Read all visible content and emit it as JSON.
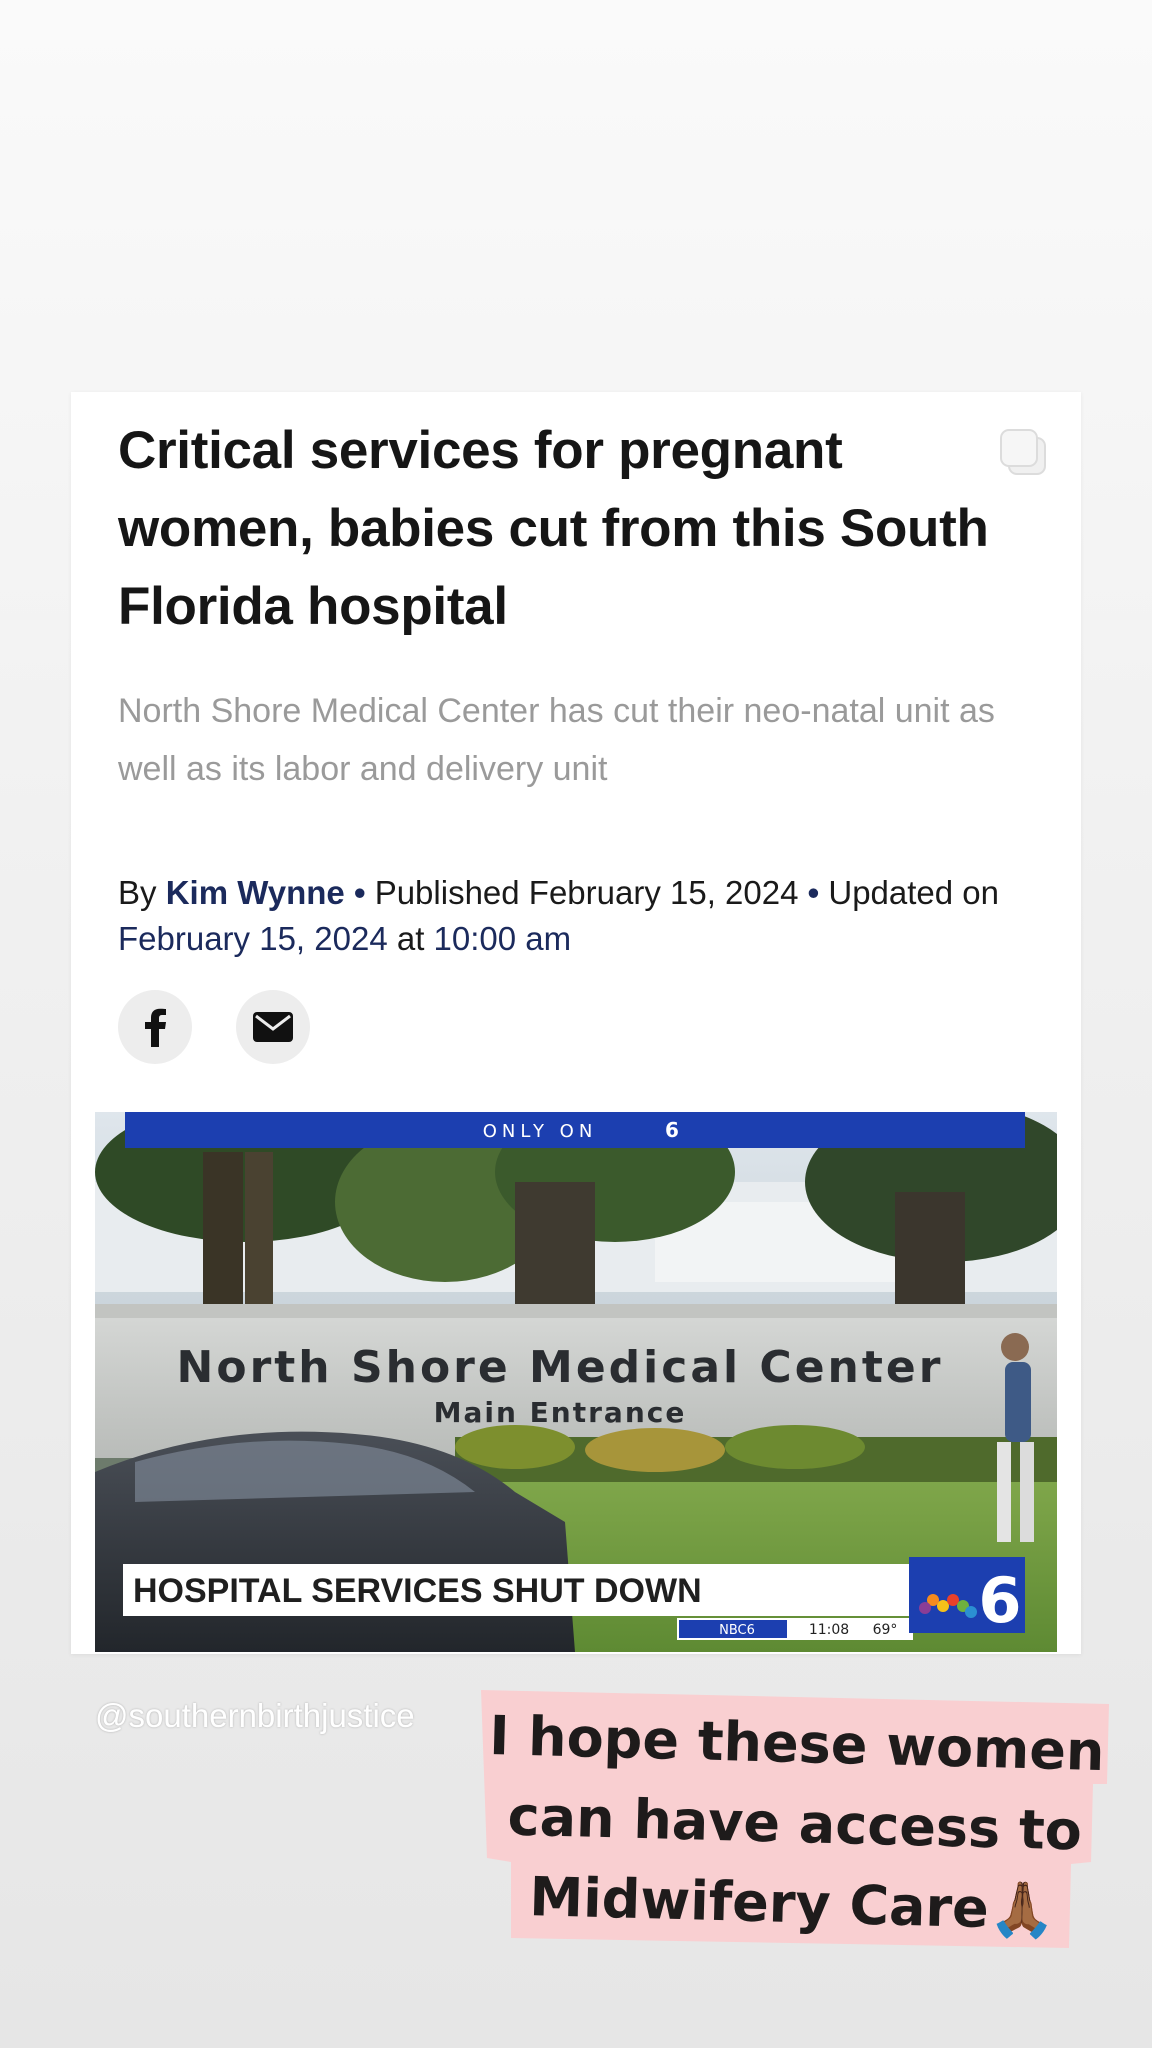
{
  "article": {
    "headline": "Critical services for pregnant women, babies cut from this South Florida hospital",
    "dek": "North Shore Medical Center has cut their neo-natal unit as well as its labor and delivery unit",
    "byline": {
      "by": "By",
      "author": "Kim Wynne",
      "separator": "•",
      "published_label": "Published February 15, 2024",
      "updated_label": "Updated on",
      "updated_date": "February 15, 2024",
      "at": "at",
      "updated_time": "10:00 am"
    },
    "share": [
      {
        "icon": "facebook-icon"
      },
      {
        "icon": "email-icon"
      }
    ]
  },
  "video": {
    "top_banner": "ONLY ON",
    "top_banner_channel": "6",
    "sign_line1": "North Shore Medical Center",
    "sign_line2": "Main Entrance",
    "lower_third": "HOSPITAL SERVICES SHUT DOWN",
    "ticker_social": "NBC6",
    "ticker_time": "11:08",
    "ticker_temp": "69°",
    "logo_number": "6"
  },
  "story": {
    "handle": "@southernbirthjustice",
    "sticker_line1": "I hope these women",
    "sticker_line2": "can have access to",
    "sticker_line3": "Midwifery Care🙏🏾"
  },
  "colors": {
    "headline": "#161616",
    "dek": "#9a9a9a",
    "author": "#1b2a5c",
    "sticker_bg": "#f9cfd1",
    "nbc_blue": "#1c3fb0"
  }
}
